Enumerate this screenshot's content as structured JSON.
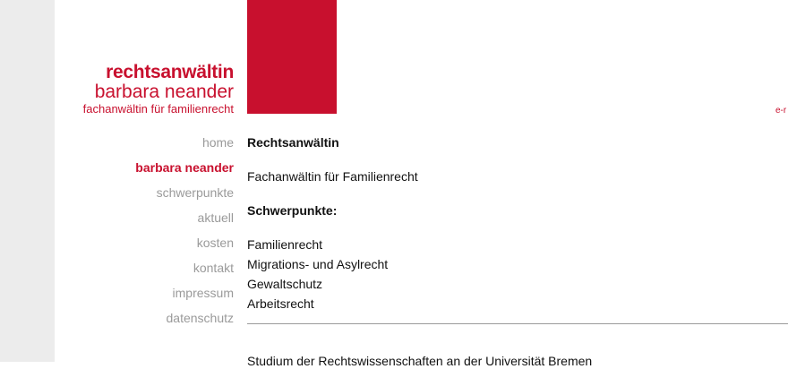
{
  "brand": {
    "line1": "rechtsanwältin",
    "line2": "barbara neander",
    "line3": "fachanwältin für familienrecht",
    "accent_color": "#c8102e"
  },
  "corner_text": "e-r",
  "nav": {
    "items": [
      {
        "label": "home",
        "active": false
      },
      {
        "label": "barbara neander",
        "active": true
      },
      {
        "label": "schwerpunkte",
        "active": false
      },
      {
        "label": "aktuell",
        "active": false
      },
      {
        "label": "kosten",
        "active": false
      },
      {
        "label": "kontakt",
        "active": false
      },
      {
        "label": "impressum",
        "active": false
      },
      {
        "label": "datenschutz",
        "active": false
      }
    ]
  },
  "content": {
    "heading": "Rechtsanwältin",
    "subtitle": "Fachanwältin für Familienrecht",
    "focus_heading": "Schwerpunkte:",
    "focus_items": [
      "Familienrecht",
      "Migrations- und Asylrecht",
      "Gewaltschutz",
      "Arbeitsrecht"
    ],
    "study": "Studium der Rechtswissenschaften an der Universität Bremen"
  }
}
